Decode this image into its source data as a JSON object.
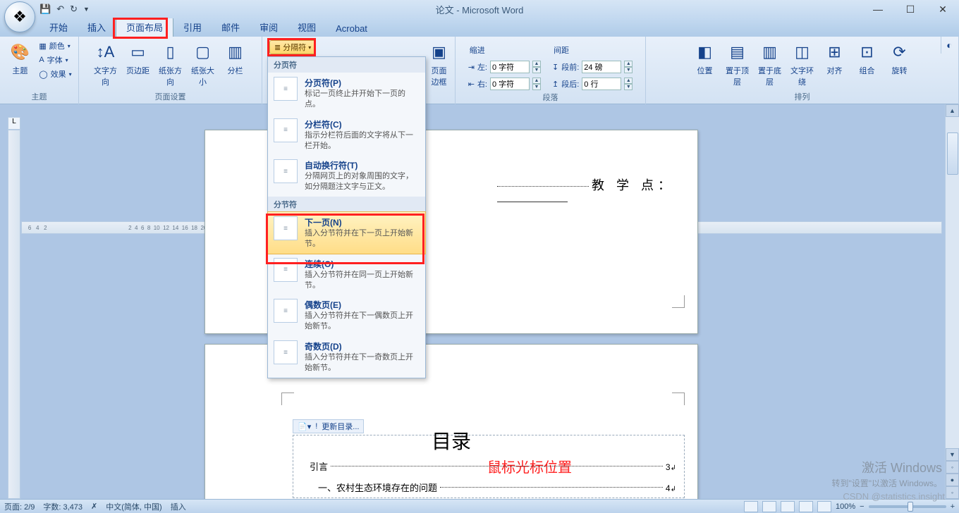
{
  "title": "论文 - Microsoft Word",
  "tabs": [
    "开始",
    "插入",
    "页面布局",
    "引用",
    "邮件",
    "审阅",
    "视图",
    "Acrobat"
  ],
  "active_tab_index": 2,
  "groups": {
    "theme": {
      "label": "主题",
      "btns": {
        "theme": "主题",
        "colors": "颜色",
        "fonts": "字体",
        "effects": "效果"
      }
    },
    "page_setup": {
      "label": "页面设置",
      "btns": {
        "direction": "文字方向",
        "margins": "页边距",
        "orientation": "纸张方向",
        "size": "纸张大小",
        "columns": "分栏"
      }
    },
    "breaks_btn": "分隔符",
    "border": {
      "label": "页面\n边框"
    },
    "indent": {
      "label": "缩进",
      "left": "左:",
      "right": "右:",
      "val_left": "0 字符",
      "val_right": "0 字符"
    },
    "spacing": {
      "label": "间距",
      "before": "段前:",
      "after": "段后:",
      "val_before": "24 磅",
      "val_after": "0 行"
    },
    "para_label": "段落",
    "arrange": {
      "label": "排列",
      "pos": "位置",
      "front": "置于顶层",
      "back": "置于底层",
      "wrap": "文字环绕",
      "align": "对齐",
      "group": "组合",
      "rotate": "旋转"
    }
  },
  "dropdown": {
    "hdr1": "分页符",
    "items1": [
      {
        "t": "分页符(P)",
        "d": "标记一页终止并开始下一页的点。"
      },
      {
        "t": "分栏符(C)",
        "d": "指示分栏符后面的文字将从下一栏开始。"
      },
      {
        "t": "自动换行符(T)",
        "d": "分隔网页上的对象周围的文字，如分隔题注文字与正文。"
      }
    ],
    "hdr2": "分节符",
    "items2": [
      {
        "t": "下一页(N)",
        "d": "插入分节符并在下一页上开始新节。",
        "sel": true
      },
      {
        "t": "连续(O)",
        "d": "插入分节符并在同一页上开始新节。"
      },
      {
        "t": "偶数页(E)",
        "d": "插入分节符并在下一偶数页上开始新节。"
      },
      {
        "t": "奇数页(D)",
        "d": "插入分节符并在下一奇数页上开始新节。"
      }
    ]
  },
  "doc": {
    "line1_label": "教 学 点：",
    "toc_update": "更新目录...",
    "toc_title": "目录",
    "red_note": "鼠标光标位置",
    "toc": [
      {
        "text": "引言",
        "page": "3"
      },
      {
        "text": "一、农村生态环境存在的问题",
        "page": "4"
      }
    ]
  },
  "status": {
    "page": "页面: 2/9",
    "words": "字数: 3,473",
    "lang": "中文(简体, 中国)",
    "mode": "插入",
    "zoom": "100%"
  },
  "watermark": {
    "l1": "激活 Windows",
    "l2": "转到\"设置\"以激活 Windows。",
    "l3": "CSDN @statistics.insight"
  }
}
